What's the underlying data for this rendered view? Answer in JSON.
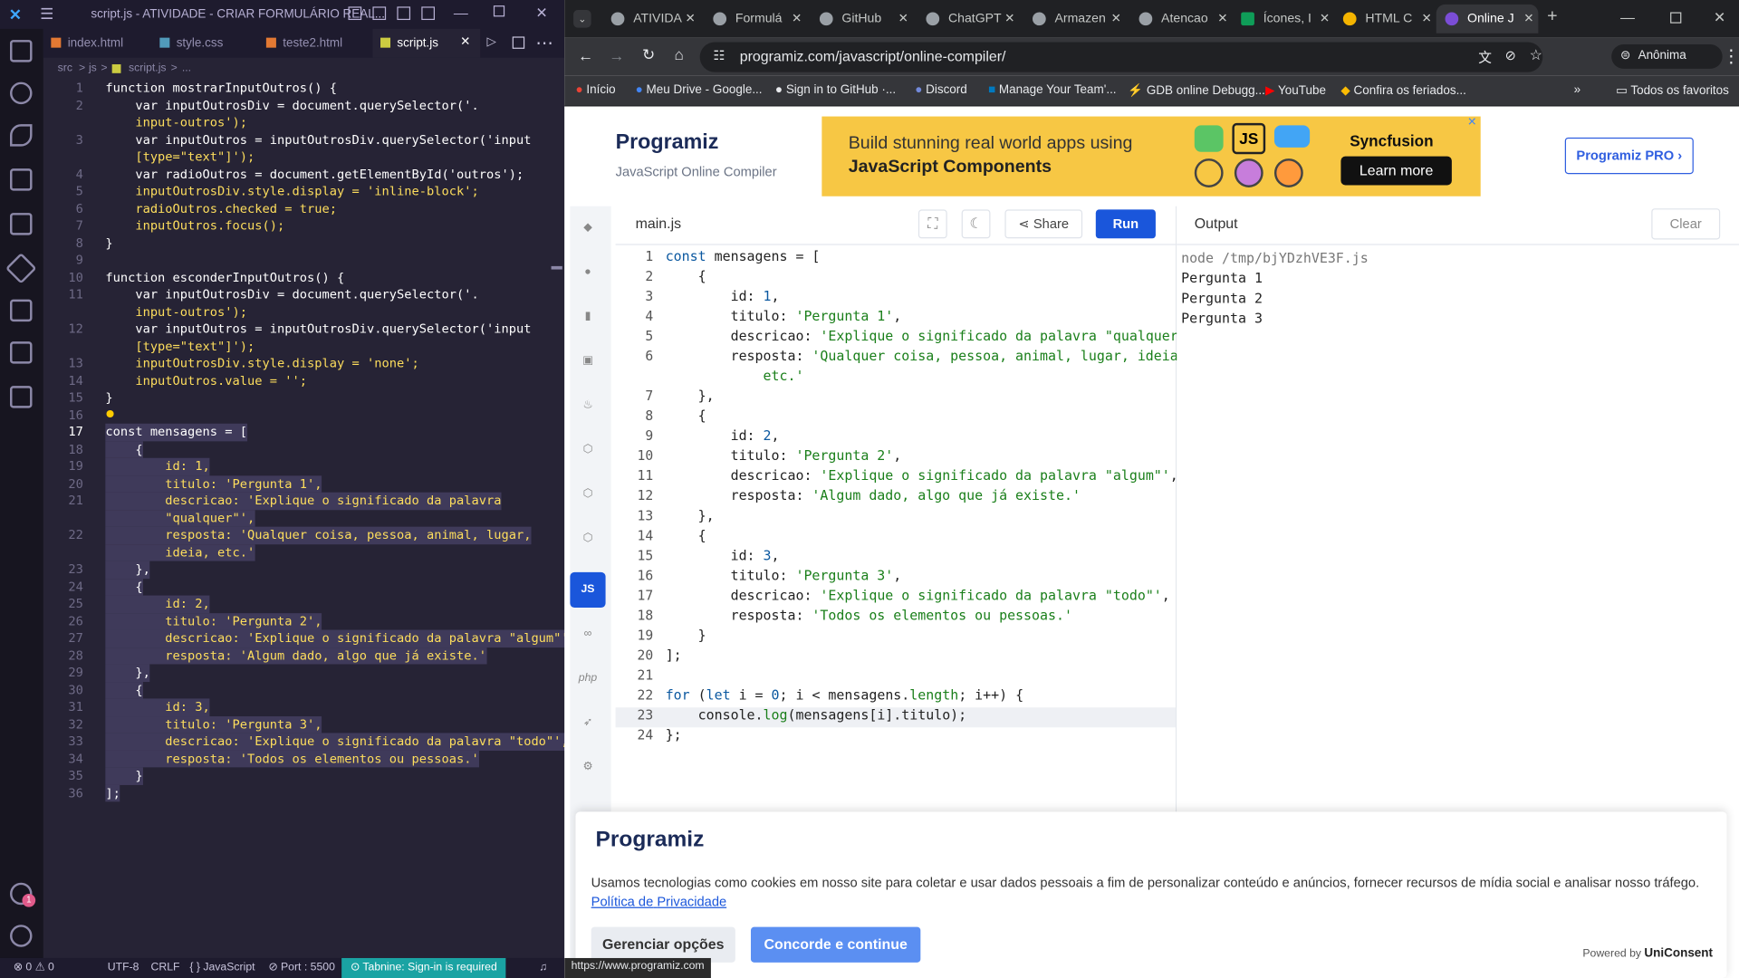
{
  "vscode": {
    "title": "script.js - ATIVIDADE - CRIAR FORMULÁRIO REAL...",
    "tabs": [
      {
        "label": "index.html"
      },
      {
        "label": "style.css"
      },
      {
        "label": "teste2.html"
      },
      {
        "label": "script.js"
      }
    ],
    "breadcrumb": {
      "folder": "src",
      "sub": "js",
      "file": "script.js",
      "more": "..."
    },
    "lines": [
      {
        "n": "1",
        "t": "function mostrarInputOutros() {"
      },
      {
        "n": "2",
        "t": "    var inputOutrosDiv = document.querySelector('."
      },
      {
        "n": "",
        "t": "    input-outros');"
      },
      {
        "n": "3",
        "t": "    var inputOutros = inputOutrosDiv.querySelector('input"
      },
      {
        "n": "",
        "t": "    [type=\"text\"]');"
      },
      {
        "n": "4",
        "t": "    var radioOutros = document.getElementById('outros');"
      },
      {
        "n": "5",
        "t": "    inputOutrosDiv.style.display = 'inline-block';"
      },
      {
        "n": "6",
        "t": "    radioOutros.checked = true;"
      },
      {
        "n": "7",
        "t": "    inputOutros.focus();"
      },
      {
        "n": "8",
        "t": "}"
      },
      {
        "n": "9",
        "t": ""
      },
      {
        "n": "10",
        "t": "function esconderInputOutros() {"
      },
      {
        "n": "11",
        "t": "    var inputOutrosDiv = document.querySelector('."
      },
      {
        "n": "",
        "t": "    input-outros');"
      },
      {
        "n": "12",
        "t": "    var inputOutros = inputOutrosDiv.querySelector('input"
      },
      {
        "n": "",
        "t": "    [type=\"text\"]');"
      },
      {
        "n": "13",
        "t": "    inputOutrosDiv.style.display = 'none';"
      },
      {
        "n": "14",
        "t": "    inputOutros.value = '';"
      },
      {
        "n": "15",
        "t": "}"
      },
      {
        "n": "16",
        "t": ""
      },
      {
        "n": "17",
        "t": "const mensagens = ["
      },
      {
        "n": "18",
        "t": "    {"
      },
      {
        "n": "19",
        "t": "        id: 1,"
      },
      {
        "n": "20",
        "t": "        titulo: 'Pergunta 1',"
      },
      {
        "n": "21",
        "t": "        descricao: 'Explique o significado da palavra"
      },
      {
        "n": "",
        "t": "        \"qualquer\"',"
      },
      {
        "n": "22",
        "t": "        resposta: 'Qualquer coisa, pessoa, animal, lugar,"
      },
      {
        "n": "",
        "t": "        ideia, etc.'"
      },
      {
        "n": "23",
        "t": "    },"
      },
      {
        "n": "24",
        "t": "    {"
      },
      {
        "n": "25",
        "t": "        id: 2,"
      },
      {
        "n": "26",
        "t": "        titulo: 'Pergunta 2',"
      },
      {
        "n": "27",
        "t": "        descricao: 'Explique o significado da palavra \"algum\"',"
      },
      {
        "n": "28",
        "t": "        resposta: 'Algum dado, algo que já existe.'"
      },
      {
        "n": "29",
        "t": "    },"
      },
      {
        "n": "30",
        "t": "    {"
      },
      {
        "n": "31",
        "t": "        id: 3,"
      },
      {
        "n": "32",
        "t": "        titulo: 'Pergunta 3',"
      },
      {
        "n": "33",
        "t": "        descricao: 'Explique o significado da palavra \"todo\"',"
      },
      {
        "n": "34",
        "t": "        resposta: 'Todos os elementos ou pessoas.'"
      },
      {
        "n": "35",
        "t": "    }"
      },
      {
        "n": "36",
        "t": "];"
      }
    ],
    "status": {
      "problems": "⊗ 0 ⚠ 0",
      "encoding": "UTF-8",
      "eol": "CRLF",
      "language": "{ } JavaScript",
      "port": "⊘ Port : 5500",
      "tabnine": "⊙ Tabnine: Sign-in is required",
      "badge": "1"
    }
  },
  "chrome": {
    "tabs": [
      {
        "label": "ATIVIDA"
      },
      {
        "label": "Formulá"
      },
      {
        "label": "GitHub"
      },
      {
        "label": "ChatGPT"
      },
      {
        "label": "Armazen"
      },
      {
        "label": "Atencao"
      },
      {
        "label": "Ícones, I"
      },
      {
        "label": "HTML C"
      },
      {
        "label": "Online J"
      }
    ],
    "url": "programiz.com/javascript/online-compiler/",
    "profile": "Anônima",
    "bookmarks": [
      {
        "label": "Início"
      },
      {
        "label": "Meu Drive - Google..."
      },
      {
        "label": "Sign in to GitHub ·..."
      },
      {
        "label": "Discord"
      },
      {
        "label": "Manage Your Team'..."
      },
      {
        "label": "GDB online Debugg..."
      },
      {
        "label": "YouTube"
      },
      {
        "label": "Confira os feriados..."
      }
    ],
    "all_bookmarks": "Todos os favoritos",
    "status_url": "https://www.programiz.com"
  },
  "programiz": {
    "logo": "Programiz",
    "subtitle": "JavaScript Online Compiler",
    "ad_line1": "Build stunning real world apps using",
    "ad_line2": "JavaScript Components",
    "ad_brand": "Syncfusion",
    "ad_cta": "Learn more",
    "ad_js": "JS",
    "pro_button": "Programiz PRO ›",
    "file_tab": "main.js",
    "share": "Share",
    "run": "Run",
    "output_title": "Output",
    "clear": "Clear",
    "langs": [
      "JS",
      "php"
    ],
    "code": [
      {
        "n": "1",
        "html": "<span class='k'>const</span> mensagens = ["
      },
      {
        "n": "2",
        "html": "    {"
      },
      {
        "n": "3",
        "html": "        id: <span class='k'>1</span>,"
      },
      {
        "n": "4",
        "html": "        titulo: <span class='s'>'Pergunta 1'</span>,"
      },
      {
        "n": "5",
        "html": "        descricao: <span class='s'>'Explique o significado da palavra \"qualquer\"'</span>,"
      },
      {
        "n": "6",
        "html": "        resposta: <span class='s'>'Qualquer coisa, pessoa, animal, lugar, ideia,</span>"
      },
      {
        "n": "",
        "html": "<span class='s'>            etc.'</span>"
      },
      {
        "n": "7",
        "html": "    },"
      },
      {
        "n": "8",
        "html": "    {"
      },
      {
        "n": "9",
        "html": "        id: <span class='k'>2</span>,"
      },
      {
        "n": "10",
        "html": "        titulo: <span class='s'>'Pergunta 2'</span>,"
      },
      {
        "n": "11",
        "html": "        descricao: <span class='s'>'Explique o significado da palavra \"algum\"'</span>,"
      },
      {
        "n": "12",
        "html": "        resposta: <span class='s'>'Algum dado, algo que já existe.'</span>"
      },
      {
        "n": "13",
        "html": "    },"
      },
      {
        "n": "14",
        "html": "    {"
      },
      {
        "n": "15",
        "html": "        id: <span class='k'>3</span>,"
      },
      {
        "n": "16",
        "html": "        titulo: <span class='s'>'Pergunta 3'</span>,"
      },
      {
        "n": "17",
        "html": "        descricao: <span class='s'>'Explique o significado da palavra \"todo\"'</span>,"
      },
      {
        "n": "18",
        "html": "        resposta: <span class='s'>'Todos os elementos ou pessoas.'</span>"
      },
      {
        "n": "19",
        "html": "    }"
      },
      {
        "n": "20",
        "html": "];"
      },
      {
        "n": "21",
        "html": ""
      },
      {
        "n": "22",
        "html": "<span class='k'>for</span> (<span class='k'>let</span> i = <span class='k'>0</span>; i &lt; mensagens.<span class='s'>length</span>; i++) {"
      },
      {
        "n": "23",
        "html": "    console.<span class='s'>log</span>(mensagens[i].titulo);"
      },
      {
        "n": "24",
        "html": "};"
      }
    ],
    "output_lines": [
      "node /tmp/bjYDzhVE3F.js",
      "Pergunta 1",
      "Pergunta 2",
      "Pergunta 3"
    ],
    "cookie_text": "Usamos tecnologias como cookies em nosso site para coletar e usar dados pessoais a fim de personalizar conteúdo e anúncios, fornecer recursos de mídia social e analisar nosso tráfego.",
    "cookie_link1": "Política de",
    "cookie_link2": "Privacidade",
    "manage": "Gerenciar opções",
    "agree": "Concorde e continue",
    "powered": "Powered by",
    "powered_brand": "UniConsent"
  },
  "colors": {
    "run": "#1a56db",
    "js_active": "#1a56db",
    "ad_bg": "#f7c744",
    "vscode_bg": "#262335"
  }
}
